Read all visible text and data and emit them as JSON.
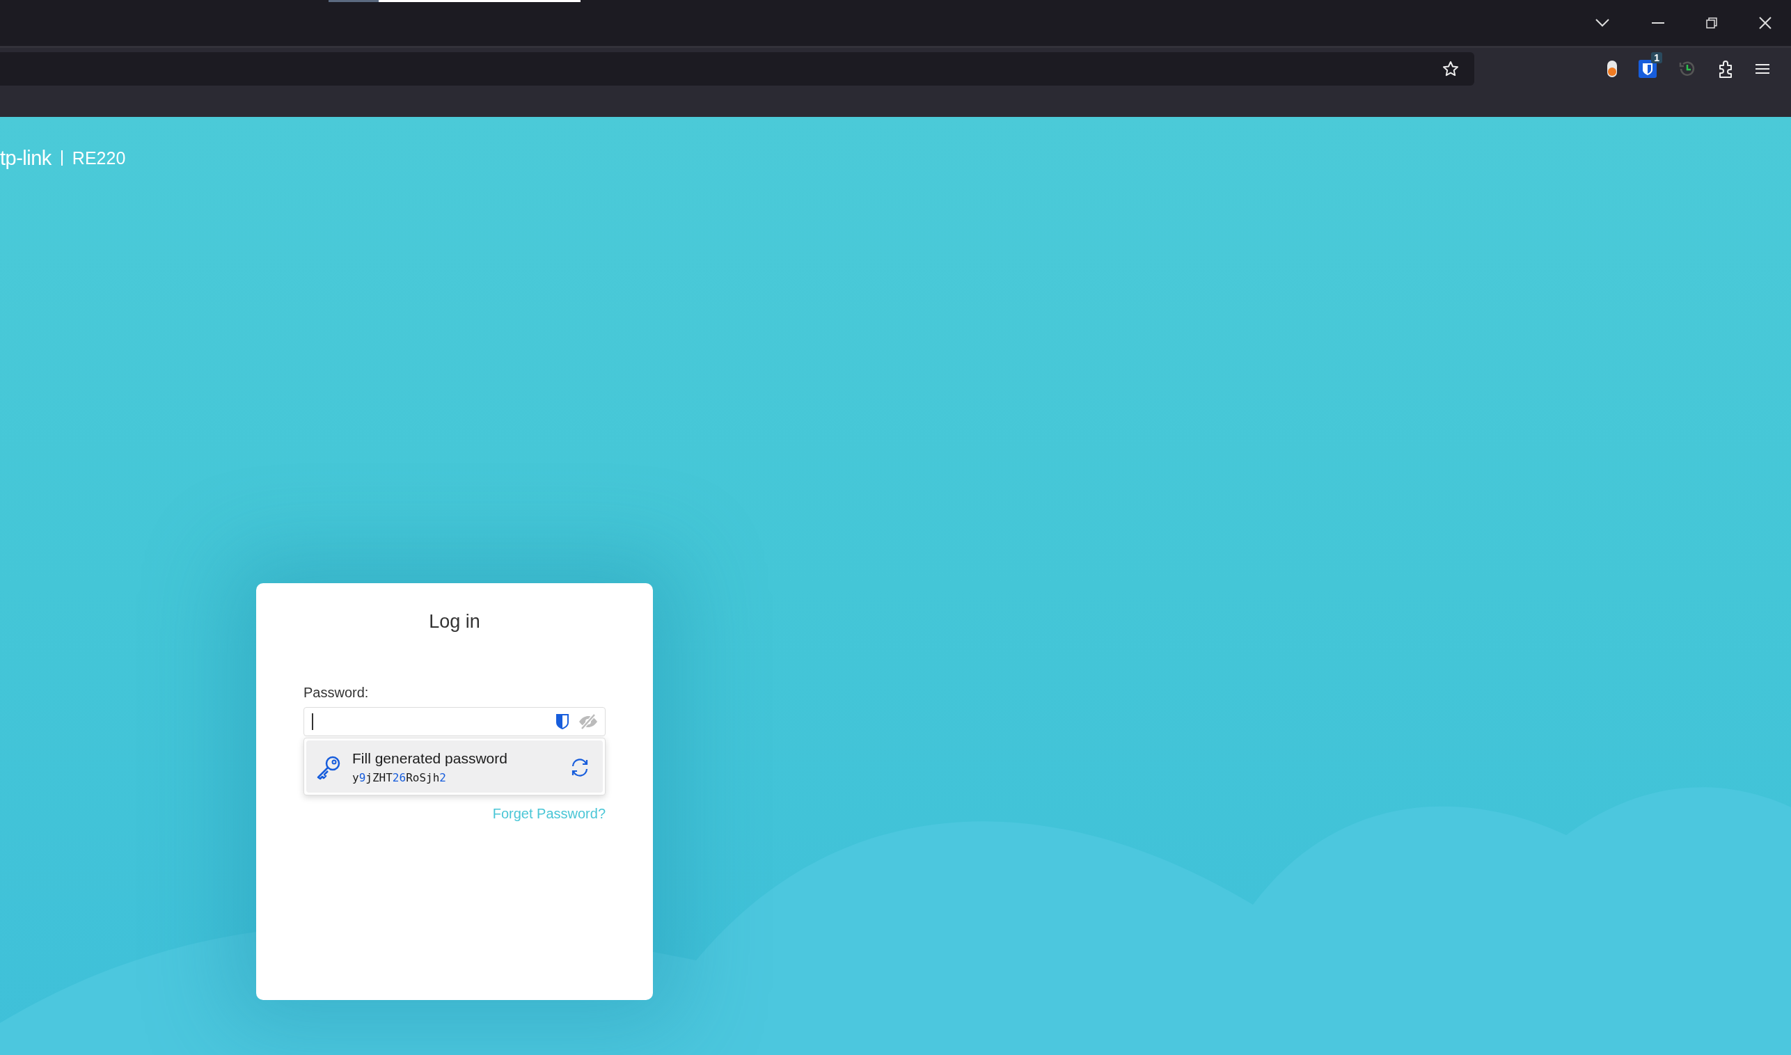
{
  "browser": {
    "badge_count": "1"
  },
  "header": {
    "logo": "tp-link",
    "model": "RE220"
  },
  "login": {
    "title": "Log in",
    "password_label": "Password:",
    "generator": {
      "title": "Fill generated password",
      "password": "y9jZHT26RoSjh2"
    },
    "forgot_link": "Forget Password?"
  }
}
